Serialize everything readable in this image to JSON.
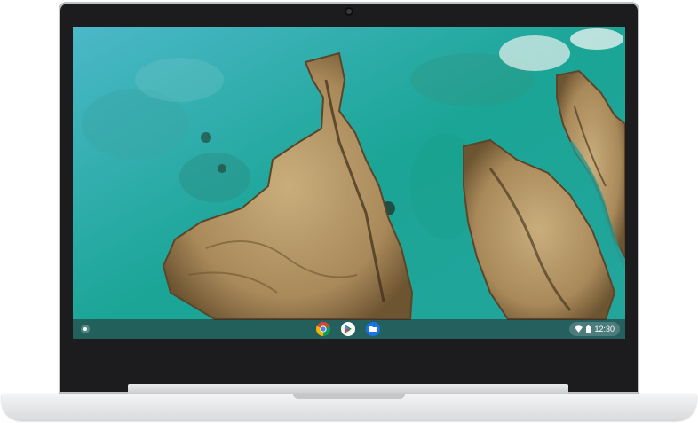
{
  "device": {
    "type": "laptop",
    "lid_color": "#bfc2c4",
    "bezel_color": "#1c1c1e"
  },
  "wallpaper": {
    "description": "",
    "water_color": "#1f9f9a",
    "land_color": "#b89a6a"
  },
  "shelf": {
    "launcher_icon": "launcher-icon",
    "apps": [
      {
        "name": "chrome-icon"
      },
      {
        "name": "play-store-icon"
      },
      {
        "name": "files-icon"
      }
    ],
    "status": {
      "wifi_icon": "wifi-icon",
      "battery_icon": "battery-icon",
      "time": "12:30"
    }
  }
}
